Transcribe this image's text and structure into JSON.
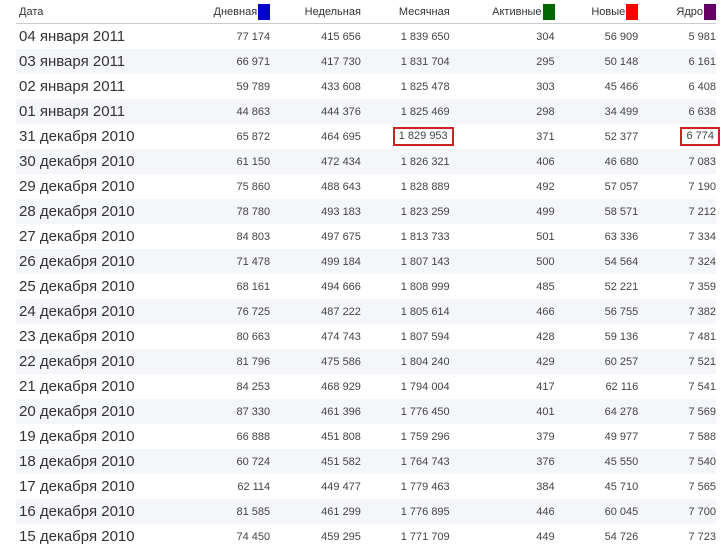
{
  "headers": {
    "date": "Дата",
    "daily": "Дневная",
    "weekly": "Недельная",
    "monthly": "Месячная",
    "active": "Активные",
    "new": "Новые",
    "core": "Ядро"
  },
  "legend_colors": {
    "daily": "#0000cc",
    "active": "#006600",
    "new": "#ff0000",
    "core": "#660066"
  },
  "highlight_color": "#cc2222",
  "rows": [
    {
      "date": "04 января 2011",
      "daily": "77 174",
      "weekly": "415 656",
      "monthly": "1 839 650",
      "active": "304",
      "new": "56 909",
      "core": "5 981"
    },
    {
      "date": "03 января 2011",
      "daily": "66 971",
      "weekly": "417 730",
      "monthly": "1 831 704",
      "active": "295",
      "new": "50 148",
      "core": "6 161"
    },
    {
      "date": "02 января 2011",
      "daily": "59 789",
      "weekly": "433 608",
      "monthly": "1 825 478",
      "active": "303",
      "new": "45 466",
      "core": "6 408"
    },
    {
      "date": "01 января 2011",
      "daily": "44 863",
      "weekly": "444 376",
      "monthly": "1 825 469",
      "active": "298",
      "new": "34 499",
      "core": "6 638"
    },
    {
      "date": "31 декабря 2010",
      "daily": "65 872",
      "weekly": "464 695",
      "monthly": "1 829 953",
      "active": "371",
      "new": "52 377",
      "core": "6 774",
      "highlight_monthly": true,
      "highlight_core": true
    },
    {
      "date": "30 декабря 2010",
      "daily": "61 150",
      "weekly": "472 434",
      "monthly": "1 826 321",
      "active": "406",
      "new": "46 680",
      "core": "7 083"
    },
    {
      "date": "29 декабря 2010",
      "daily": "75 860",
      "weekly": "488 643",
      "monthly": "1 828 889",
      "active": "492",
      "new": "57 057",
      "core": "7 190"
    },
    {
      "date": "28 декабря 2010",
      "daily": "78 780",
      "weekly": "493 183",
      "monthly": "1 823 259",
      "active": "499",
      "new": "58 571",
      "core": "7 212"
    },
    {
      "date": "27 декабря 2010",
      "daily": "84 803",
      "weekly": "497 675",
      "monthly": "1 813 733",
      "active": "501",
      "new": "63 336",
      "core": "7 334"
    },
    {
      "date": "26 декабря 2010",
      "daily": "71 478",
      "weekly": "499 184",
      "monthly": "1 807 143",
      "active": "500",
      "new": "54 564",
      "core": "7 324"
    },
    {
      "date": "25 декабря 2010",
      "daily": "68 161",
      "weekly": "494 666",
      "monthly": "1 808 999",
      "active": "485",
      "new": "52 221",
      "core": "7 359"
    },
    {
      "date": "24 декабря 2010",
      "daily": "76 725",
      "weekly": "487 222",
      "monthly": "1 805 614",
      "active": "466",
      "new": "56 755",
      "core": "7 382"
    },
    {
      "date": "23 декабря 2010",
      "daily": "80 663",
      "weekly": "474 743",
      "monthly": "1 807 594",
      "active": "428",
      "new": "59 136",
      "core": "7 481"
    },
    {
      "date": "22 декабря 2010",
      "daily": "81 796",
      "weekly": "475 586",
      "monthly": "1 804 240",
      "active": "429",
      "new": "60 257",
      "core": "7 521"
    },
    {
      "date": "21 декабря 2010",
      "daily": "84 253",
      "weekly": "468 929",
      "monthly": "1 794 004",
      "active": "417",
      "new": "62 116",
      "core": "7 541"
    },
    {
      "date": "20 декабря 2010",
      "daily": "87 330",
      "weekly": "461 396",
      "monthly": "1 776 450",
      "active": "401",
      "new": "64 278",
      "core": "7 569"
    },
    {
      "date": "19 декабря 2010",
      "daily": "66 888",
      "weekly": "451 808",
      "monthly": "1 759 296",
      "active": "379",
      "new": "49 977",
      "core": "7 588"
    },
    {
      "date": "18 декабря 2010",
      "daily": "60 724",
      "weekly": "451 582",
      "monthly": "1 764 743",
      "active": "376",
      "new": "45 550",
      "core": "7 540"
    },
    {
      "date": "17 декабря 2010",
      "daily": "62 114",
      "weekly": "449 477",
      "monthly": "1 779 463",
      "active": "384",
      "new": "45 710",
      "core": "7 565"
    },
    {
      "date": "16 декабря 2010",
      "daily": "81 585",
      "weekly": "461 299",
      "monthly": "1 776 895",
      "active": "446",
      "new": "60 045",
      "core": "7 700"
    },
    {
      "date": "15 декабря 2010",
      "daily": "74 450",
      "weekly": "459 295",
      "monthly": "1 771 709",
      "active": "449",
      "new": "54 726",
      "core": "7 723"
    }
  ]
}
